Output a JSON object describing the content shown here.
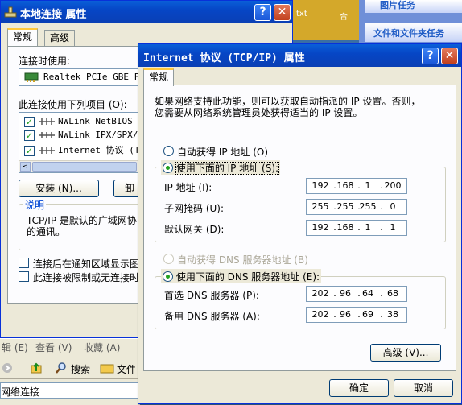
{
  "background": {
    "desktop_text_left": "txt",
    "desktop_text_right": "合",
    "explorer_task_top": "图片任务",
    "explorer_task_folder": "文件和文件夹任务"
  },
  "back_window": {
    "title": "本地连接 属性",
    "help_button": "?",
    "close_button": "✕",
    "tabs": [
      "常规",
      "高级"
    ],
    "connect_using_label": "连接时使用:",
    "adapter_name": "Realtek PCIe GBE Fa",
    "items_label": "此连接使用下列项目 (O):",
    "items": [
      {
        "label": "NWLink NetBIOS",
        "checked": true
      },
      {
        "label": "NWLink IPX/SPX/Ne",
        "checked": true
      },
      {
        "label": "Internet 协议 (TC",
        "checked": true
      }
    ],
    "install_button": "安装 (N)...",
    "uninstall_button": "卸",
    "description_title": "说明",
    "description_text_1": "TCP/IP 是默认的广域网协",
    "description_text_2": "的通讯。",
    "option_notify": "连接后在通知区域显示图",
    "option_limited": "此连接被限制或无连接时"
  },
  "explorer_bottom": {
    "menu_items": [
      "辑 (E)",
      "查看 (V)",
      "收藏 (A)"
    ],
    "search_label": "搜索",
    "folder_label": "文件",
    "address_value": "网络连接"
  },
  "front_window": {
    "title": "Internet 协议 (TCP/IP) 属性",
    "help_button": "?",
    "close_button": "✕",
    "tab": "常规",
    "intro_line_1": "如果网络支持此功能，则可以获取自动指派的 IP 设置。否则，",
    "intro_line_2": "您需要从网络系统管理员处获得适当的 IP 设置。",
    "radio_auto_ip": "自动获得 IP 地址 (O)",
    "radio_manual_ip": "使用下面的 IP 地址 (S):",
    "ip_label": "IP 地址 (I):",
    "ip_value": [
      "192",
      "168",
      "1",
      "200"
    ],
    "mask_label": "子网掩码 (U):",
    "mask_value": [
      "255",
      "255",
      "255",
      "0"
    ],
    "gateway_label": "默认网关 (D):",
    "gateway_value": [
      "192",
      "168",
      "1",
      "1"
    ],
    "radio_auto_dns": "自动获得 DNS 服务器地址 (B)",
    "radio_manual_dns": "使用下面的 DNS 服务器地址 (E):",
    "dns_pref_label": "首选 DNS 服务器 (P):",
    "dns_pref_value": [
      "202",
      "96",
      "64",
      "68"
    ],
    "dns_alt_label": "备用 DNS 服务器 (A):",
    "dns_alt_value": [
      "202",
      "96",
      "69",
      "38"
    ],
    "advanced_button": "高级 (V)...",
    "ok_button": "确定",
    "cancel_button": "取消"
  },
  "colors": {
    "title_blue": "#0646c6",
    "dialog_face": "#ece9d8",
    "radio_dot": "#21a121",
    "close_red": "#c2401d"
  }
}
